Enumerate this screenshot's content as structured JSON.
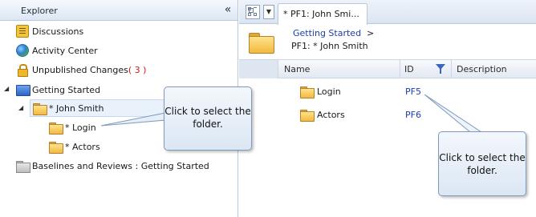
{
  "explorer": {
    "title": "Explorer",
    "collapse_glyph": "«",
    "items": [
      {
        "label": "Discussions",
        "icon": "discussion-icon"
      },
      {
        "label": "Activity Center",
        "icon": "activity-center-icon"
      },
      {
        "label": "Unpublished Changes",
        "count": "( 3 )",
        "icon": "lock-icon"
      },
      {
        "label": "Getting Started",
        "icon": "project-icon"
      },
      {
        "label": "* John Smith",
        "icon": "folder-icon"
      },
      {
        "label": "* Login",
        "icon": "folder-icon"
      },
      {
        "label": "* Actors",
        "icon": "folder-icon"
      },
      {
        "label": "Baselines and Reviews : Getting Started",
        "icon": "baseline-icon"
      }
    ]
  },
  "tabbar": {
    "tab_label": "* PF1: John Smi..."
  },
  "breadcrumb": {
    "parent": "Getting Started",
    "separator": ">",
    "current": "PF1: * John Smith"
  },
  "grid": {
    "columns": [
      "Name",
      "ID",
      "Description"
    ],
    "rows": [
      {
        "name": "Login",
        "id": "PF5"
      },
      {
        "name": "Actors",
        "id": "PF6"
      }
    ]
  },
  "callouts": {
    "left": "Click to select the folder.",
    "right": "Click to select the folder."
  },
  "colors": {
    "link": "#1b3fa6",
    "count": "#d01b1b",
    "callout_border": "#7f99be"
  }
}
